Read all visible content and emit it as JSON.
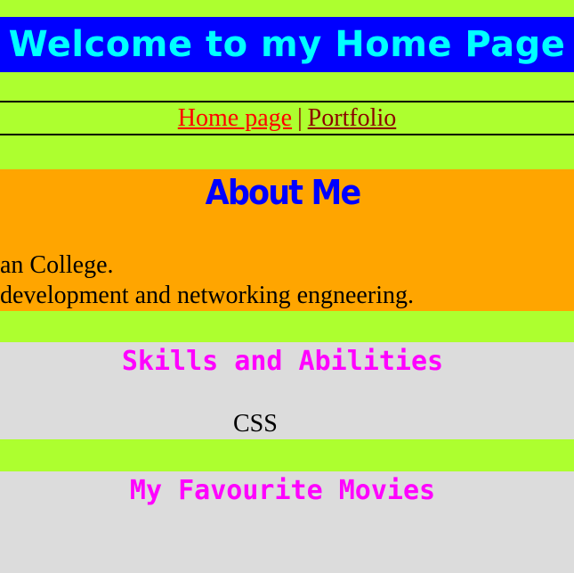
{
  "header": {
    "title": "Welcome to my Home Page"
  },
  "nav": {
    "home_label": "Home page",
    "separator": "|",
    "portfolio_label": "Portfolio"
  },
  "about": {
    "heading": "About Me",
    "line1": "an College.",
    "line2": " development and networking engneering."
  },
  "skills": {
    "heading": "Skills and Abilities",
    "item": "CSS"
  },
  "movies": {
    "heading": "My Favourite Movies"
  },
  "colors": {
    "page_bg": "#adff2f",
    "header_bg": "#0000ff",
    "header_text": "#00ffff",
    "about_bg": "#ffa500",
    "about_heading": "#0000ff",
    "section_bg": "#dcdcdc",
    "section_heading": "#ff00ff",
    "link_home": "#ff0000",
    "link_portfolio": "#8b0000"
  }
}
